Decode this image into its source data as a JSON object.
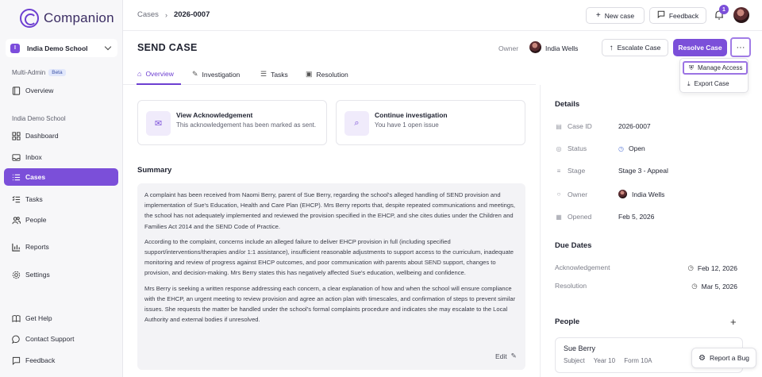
{
  "app": {
    "name": "Companion"
  },
  "sidebar": {
    "school": {
      "badge": "I",
      "name": "India Demo School"
    },
    "multi_admin_label": "Multi-Admin",
    "beta_label": "Beta",
    "overview": "Overview",
    "school_section_label": "India Demo School",
    "items": [
      {
        "label": "Dashboard",
        "icon": "dashboard-icon"
      },
      {
        "label": "Inbox",
        "icon": "inbox-icon"
      },
      {
        "label": "Cases",
        "icon": "list-icon",
        "active": true
      },
      {
        "label": "Tasks",
        "icon": "tasks-icon"
      },
      {
        "label": "People",
        "icon": "people-icon"
      },
      {
        "label": "Reports",
        "icon": "chart-icon"
      },
      {
        "label": "Settings",
        "icon": "gear-icon"
      }
    ],
    "footer": [
      {
        "label": "Get Help",
        "icon": "book-icon"
      },
      {
        "label": "Contact Support",
        "icon": "chat-icon"
      },
      {
        "label": "Feedback",
        "icon": "feedback-icon"
      }
    ]
  },
  "header": {
    "breadcrumb": {
      "parent": "Cases",
      "current": "2026-0007"
    },
    "new_case": "New case",
    "feedback": "Feedback",
    "notification_count": "1"
  },
  "case": {
    "title": "SEND CASE",
    "owner_label": "Owner",
    "owner_name": "India Wells",
    "escalate": "Escalate Case",
    "resolve": "Resolve Case",
    "more": "···"
  },
  "tabs": [
    {
      "label": "Overview",
      "active": true
    },
    {
      "label": "Investigation"
    },
    {
      "label": "Tasks"
    },
    {
      "label": "Resolution"
    }
  ],
  "menu": {
    "manage_access": "Manage Access",
    "export_case": "Export Case"
  },
  "cards": {
    "ack": {
      "title": "View Acknowledgement",
      "sub": "This acknowledgement has been marked as sent."
    },
    "investigation": {
      "title": "Continue investigation",
      "sub": "You have 1 open issue"
    }
  },
  "summary": {
    "heading": "Summary",
    "paragraphs": [
      "A complaint has been received from Naomi Berry, parent of Sue Berry, regarding the school's alleged handling of SEND provision and implementation of Sue's Education, Health and Care Plan (EHCP). Mrs Berry reports that, despite repeated communications and meetings, the school has not adequately implemented and reviewed the provision specified in the EHCP, and she cites duties under the Children and Families Act 2014 and the SEND Code of Practice.",
      "According to the complaint, concerns include an alleged failure to deliver EHCP provision in full (including specified support/interventions/therapies and/or 1:1 assistance), insufficient reasonable adjustments to support access to the curriculum, inadequate monitoring and review of progress against EHCP outcomes, and poor communication with parents about SEND support, changes to provision, and decision-making. Mrs Berry states this has negatively affected Sue's education, wellbeing and confidence.",
      "Mrs Berry is seeking a written response addressing each concern, a clear explanation of how and when the school will ensure compliance with the EHCP, an urgent meeting to review provision and agree an action plan with timescales, and confirmation of steps to prevent similar issues. She requests the matter be handled under the school's formal complaints procedure and indicates she may escalate to the Local Authority and external bodies if unresolved."
    ],
    "edit": "Edit"
  },
  "details": {
    "heading": "Details",
    "rows": [
      {
        "key": "Case ID",
        "value": "2026-0007"
      },
      {
        "key": "Status",
        "value": "Open"
      },
      {
        "key": "Stage",
        "value": "Stage 3 - Appeal"
      },
      {
        "key": "Owner",
        "value": "India Wells"
      },
      {
        "key": "Opened",
        "value": "Feb 5, 2026"
      }
    ]
  },
  "due_dates": {
    "heading": "Due Dates",
    "rows": [
      {
        "key": "Acknowledgement",
        "value": "Feb 12, 2026"
      },
      {
        "key": "Resolution",
        "value": "Mar 5, 2026"
      }
    ]
  },
  "people": {
    "heading": "People",
    "add": "+",
    "person": {
      "name": "Sue Berry",
      "role": "Subject",
      "year": "Year 10",
      "form": "Form 10A"
    }
  },
  "report_bug": "Report a Bug",
  "colors": {
    "accent": "#7b4fd9",
    "sidebar_bg": "#f7f7f9"
  }
}
